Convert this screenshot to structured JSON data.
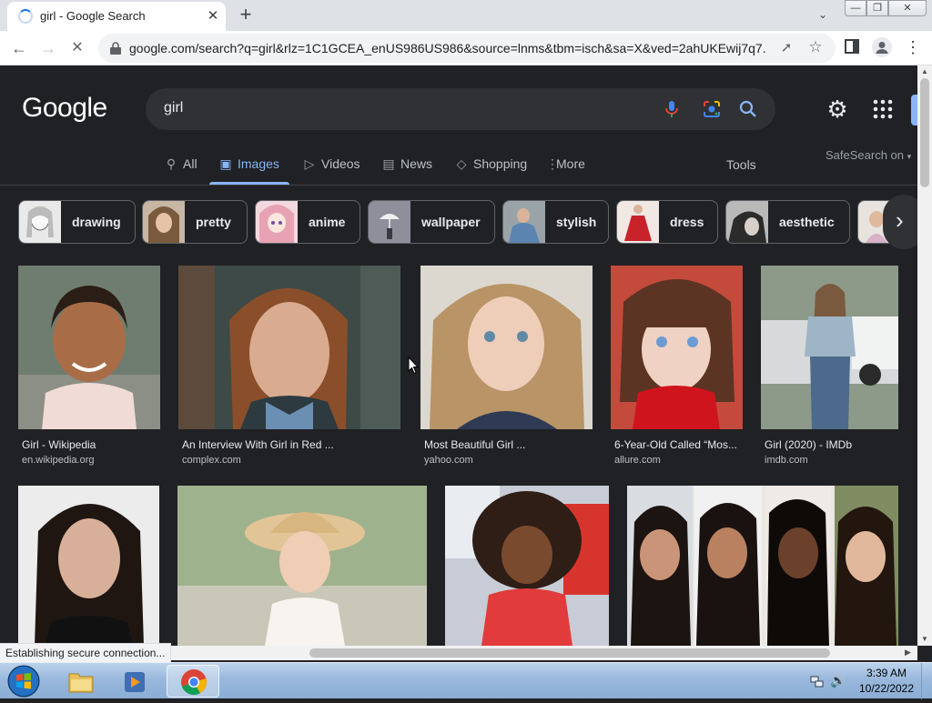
{
  "browser": {
    "tab_title": "girl - Google Search",
    "tab_close": "✕",
    "new_tab": "+",
    "tab_list": "⌄",
    "url": "google.com/search?q=girl&rlz=1C1GCEA_enUS986US986&source=lnms&tbm=isch&sa=X&ved=2ahUKEwij7q7...",
    "status_text": "Establishing secure connection..."
  },
  "google": {
    "logo": "Google",
    "query": "girl",
    "tabs": [
      {
        "label": "All",
        "icon": "search-icon"
      },
      {
        "label": "Images",
        "icon": "image-icon"
      },
      {
        "label": "Videos",
        "icon": "video-icon"
      },
      {
        "label": "News",
        "icon": "news-icon"
      },
      {
        "label": "Shopping",
        "icon": "tag-icon"
      },
      {
        "label": "More",
        "icon": "more-vert-icon"
      }
    ],
    "tools": "Tools",
    "safesearch": "SafeSearch on",
    "chips": [
      {
        "label": "drawing"
      },
      {
        "label": "pretty"
      },
      {
        "label": "anime"
      },
      {
        "label": "wallpaper"
      },
      {
        "label": "stylish"
      },
      {
        "label": "dress"
      },
      {
        "label": "aesthetic"
      }
    ],
    "results_row1": [
      {
        "title": "Girl - Wikipedia",
        "source": "en.wikipedia.org"
      },
      {
        "title": "An Interview With Girl in Red ...",
        "source": "complex.com"
      },
      {
        "title": "Most Beautiful Girl ...",
        "source": "yahoo.com"
      },
      {
        "title": "6-Year-Old Called “Mos...",
        "source": "allure.com"
      },
      {
        "title": "Girl (2020) - IMDb",
        "source": "imdb.com"
      }
    ]
  },
  "taskbar": {
    "time": "3:39 AM",
    "date": "10/22/2022"
  },
  "colors": {
    "page_bg": "#202124",
    "accent": "#8ab4f8",
    "search_bar": "#303134"
  }
}
